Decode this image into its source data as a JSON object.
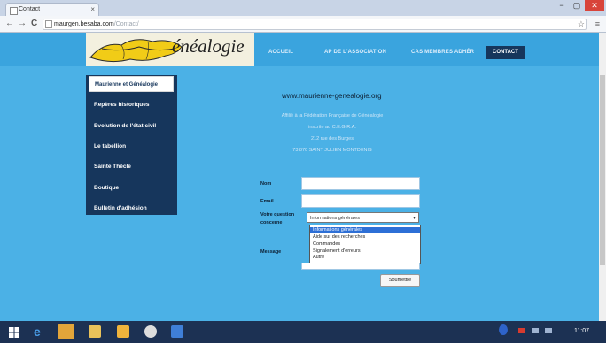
{
  "browser": {
    "tab_title": "Contact",
    "tab_close": "×",
    "url_domain": "maurgen.besaba.com",
    "url_path": "/Contact/",
    "back": "←",
    "forward": "→",
    "reload": "C",
    "window_minimize": "−",
    "window_maximize": "▢",
    "window_close": "✕",
    "star": "☆",
    "menu": "≡"
  },
  "header": {
    "logo_text": "énéalogie",
    "nav": [
      "ACCUEIL",
      "AP DE L'ASSOCIATION",
      "CAS MEMBRES ADHÉR",
      "CONTACT"
    ]
  },
  "sidebar": {
    "items": [
      "Maurienne et Généalogie",
      "Repères historiques",
      "Evolution de l'état civil",
      "Le tabellion",
      "Sainte Thècle",
      "Boutique",
      "Bulletin d'adhésion"
    ]
  },
  "main": {
    "site_title": "www.maurienne-genealogie.org",
    "info_lines": [
      "Affilié à la Fédération Française de Généalogie",
      "inscrite au C.E.G.R.A.",
      "212 rue des Burges",
      "73 870 SAINT JULIEN MONTDENIS"
    ]
  },
  "form": {
    "name_label": "Nom",
    "email_label": "Email",
    "question_label_1": "Votre question",
    "question_label_2": "concerne",
    "select_value": "Informations générales",
    "select_arrow": "▾",
    "options": [
      "Informations générales",
      "Aide sur des recherches",
      "Commandes",
      "Signalement d'erreurs",
      "Autre"
    ],
    "message_label": "Message",
    "submit_label": "Soumettre"
  },
  "taskbar": {
    "clock": "11:07"
  },
  "colors": {
    "page_bg": "#4bb1e6",
    "nav_dark": "#16365c",
    "selected_option": "#2d6fd6",
    "taskbar": "#1c3153"
  }
}
